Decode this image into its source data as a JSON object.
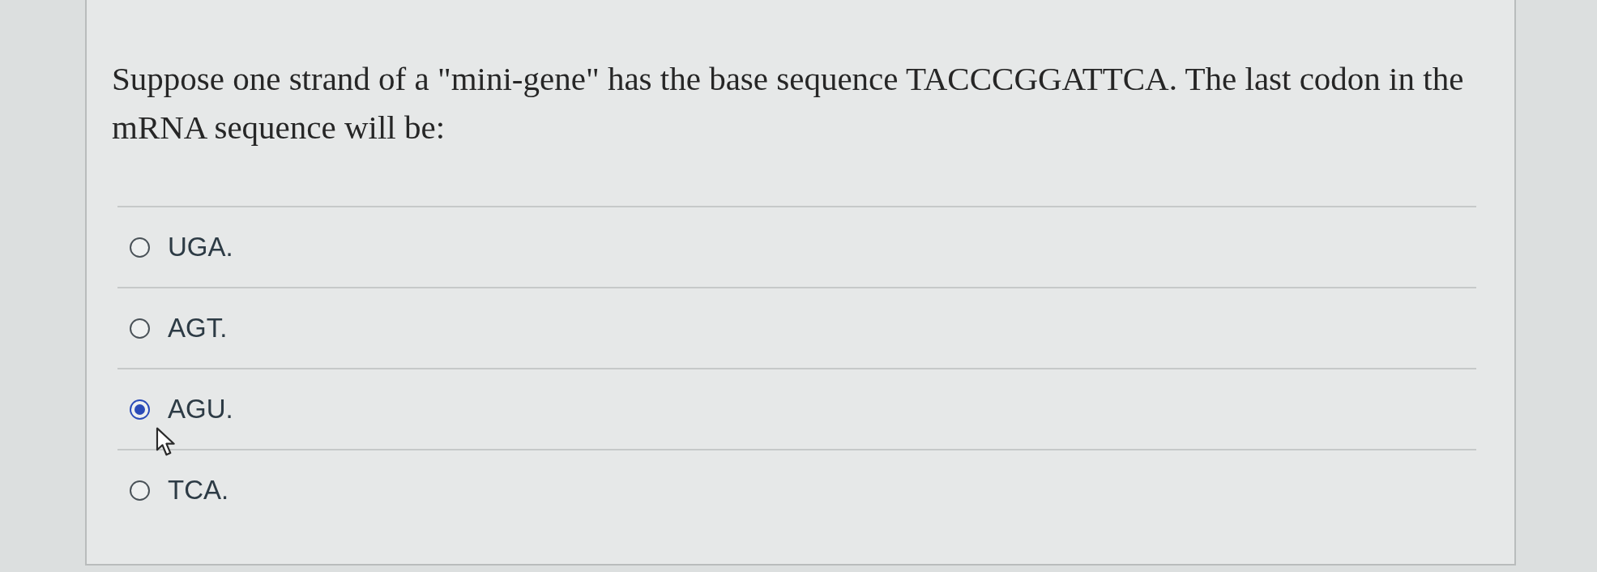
{
  "question": {
    "text": "Suppose one strand of a \"mini-gene\" has the base sequence TACCCGGATTCA. The last codon in the mRNA sequence will be:",
    "options": [
      {
        "label": "UGA.",
        "selected": false
      },
      {
        "label": "AGT.",
        "selected": false
      },
      {
        "label": "AGU.",
        "selected": true
      },
      {
        "label": "TCA.",
        "selected": false
      }
    ]
  }
}
